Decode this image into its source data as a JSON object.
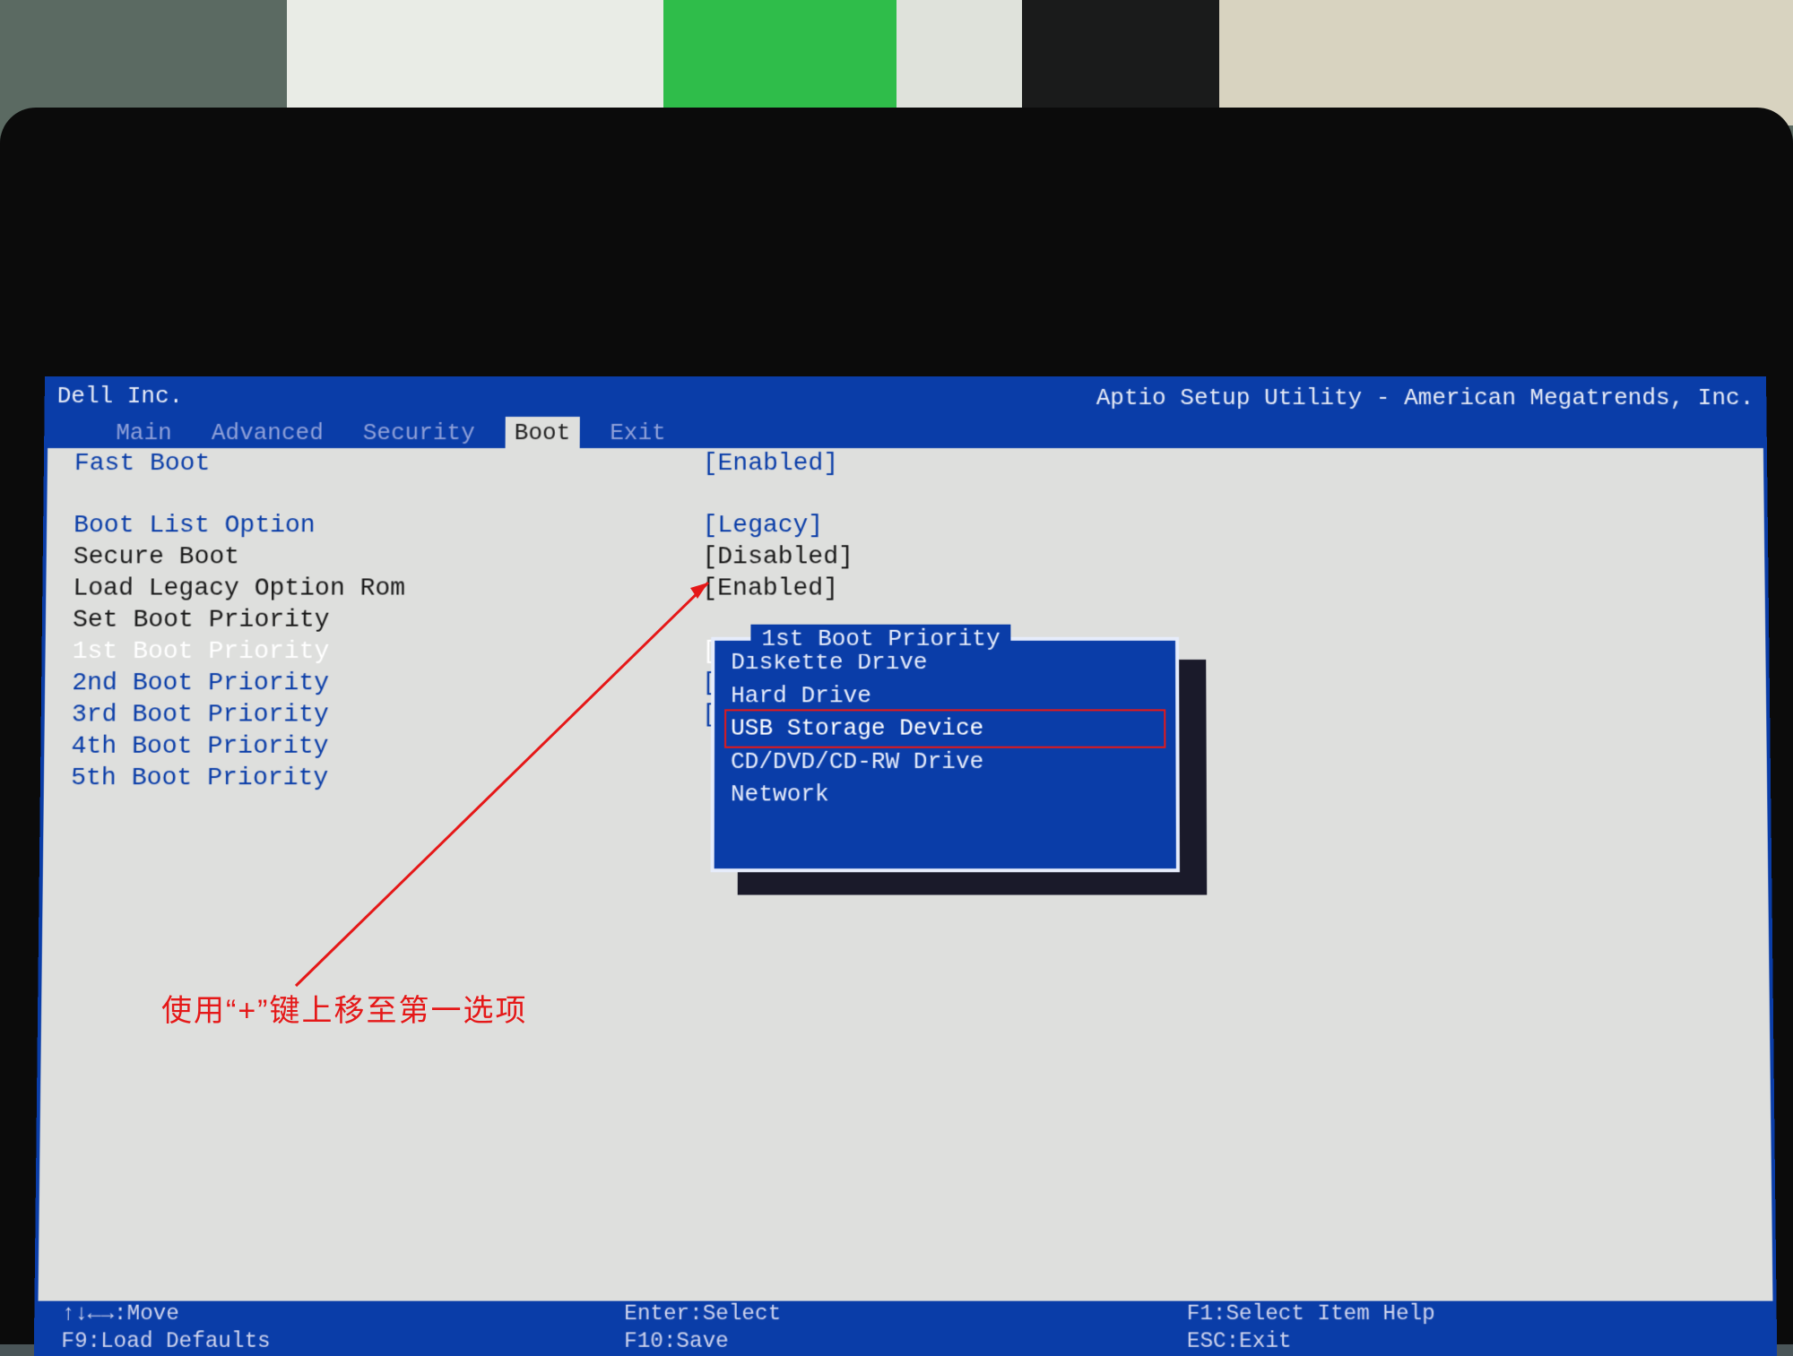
{
  "header": {
    "vendor": "Dell Inc.",
    "utility_title": "Aptio Setup Utility - American Megatrends, Inc."
  },
  "tabs": {
    "items": [
      "Main",
      "Advanced",
      "Security",
      "Boot",
      "Exit"
    ],
    "active_index": 3
  },
  "settings": [
    {
      "label": "Fast Boot",
      "value": "[Enabled]",
      "style": "blue"
    },
    {
      "blank": true
    },
    {
      "label": "Boot List Option",
      "value": "[Legacy]",
      "style": "blue"
    },
    {
      "label": "Secure Boot",
      "value": "[Disabled]",
      "style": "black"
    },
    {
      "label": "Load Legacy Option Rom",
      "value": "[Enabled]",
      "style": "black"
    },
    {
      "label": "Set Boot Priority",
      "value": "",
      "style": "black"
    },
    {
      "label": "1st Boot Priority",
      "value": "[Hard Drive]",
      "style": "white"
    },
    {
      "label": "2nd Boot Priority",
      "value": "[USB Storage Device]",
      "style": "blue"
    },
    {
      "label": "3rd Boot Priority",
      "value": "[Diskette Drive]",
      "style": "blue"
    },
    {
      "label": "4th Boot Priority",
      "value": "",
      "style": "blue"
    },
    {
      "label": "5th Boot Priority",
      "value": "",
      "style": "blue"
    }
  ],
  "popup": {
    "title": "1st Boot Priority",
    "options": [
      "Diskette Drive",
      "Hard Drive",
      "USB Storage Device",
      "CD/DVD/CD-RW Drive",
      "Network"
    ],
    "selected_index": 2
  },
  "footer": {
    "col1a": "↑↓←→:Move",
    "col1b": "F9:Load Defaults",
    "col2a": "Enter:Select",
    "col2b": "F10:Save",
    "col3a": "F1:Select Item Help",
    "col3b": "ESC:Exit"
  },
  "annotation": {
    "text": "使用“+”键上移至第一选项"
  }
}
